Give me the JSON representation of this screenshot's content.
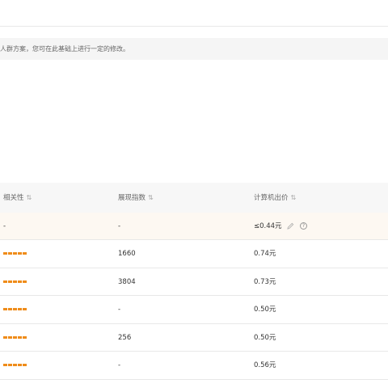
{
  "notice": {
    "text": "人群方案，您可在此基础上进行一定的修改。"
  },
  "table": {
    "headers": {
      "relevance": "相关性",
      "impressions": "展现指数",
      "pc_bid": "计算机出价"
    },
    "sort_glyph": "⇅",
    "highlight_row": {
      "relevance": "-",
      "impressions": "-",
      "pc_bid": "≤0.44元"
    },
    "rows": [
      {
        "relevance_level": 5,
        "impressions": "1660",
        "pc_bid": "0.74元"
      },
      {
        "relevance_level": 5,
        "impressions": "3804",
        "pc_bid": "0.73元"
      },
      {
        "relevance_level": 5,
        "impressions": "-",
        "pc_bid": "0.50元"
      },
      {
        "relevance_level": 5,
        "impressions": "256",
        "pc_bid": "0.50元"
      },
      {
        "relevance_level": 5,
        "impressions": "-",
        "pc_bid": "0.56元"
      }
    ],
    "bar_color": "#ef8c1a"
  },
  "icons": {
    "edit": "pencil-icon",
    "help": "help-icon"
  }
}
